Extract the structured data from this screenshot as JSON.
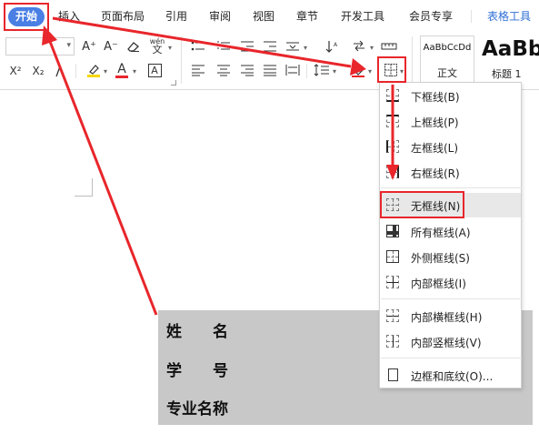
{
  "menu_tabs": {
    "home": "开始",
    "insert": "插入",
    "layout": "页面布局",
    "references": "引用",
    "review": "审阅",
    "view": "视图",
    "sections": "章节",
    "developer": "开发工具",
    "member": "会员专享",
    "table_tools": "表格工具"
  },
  "ribbon": {
    "font_size_up": "A⁺",
    "font_size_down": "A⁻",
    "pinyin_label": "wén",
    "superscript": "X²",
    "subscript": "X₂",
    "font_color_letter": "A",
    "char_border_letter": "A"
  },
  "styles": {
    "normal_sample": "AaBbCcDd",
    "normal_name": "正文",
    "heading1_sample": "AaBb",
    "heading1_name": "标题 1"
  },
  "border_menu": {
    "items": [
      {
        "label": "下框线(B)",
        "icon": "border-bottom-icon"
      },
      {
        "label": "上框线(P)",
        "icon": "border-top-icon"
      },
      {
        "label": "左框线(L)",
        "icon": "border-left-icon"
      },
      {
        "label": "右框线(R)",
        "icon": "border-right-icon"
      },
      {
        "label": "无框线(N)",
        "icon": "border-none-icon"
      },
      {
        "label": "所有框线(A)",
        "icon": "border-all-icon"
      },
      {
        "label": "外侧框线(S)",
        "icon": "border-outside-icon"
      },
      {
        "label": "内部框线(I)",
        "icon": "border-inside-icon"
      },
      {
        "label": "内部横框线(H)",
        "icon": "border-inside-horizontal-icon"
      },
      {
        "label": "内部竖框线(V)",
        "icon": "border-inside-vertical-icon"
      },
      {
        "label": "边框和底纹(O)...",
        "icon": "borders-shading-icon"
      }
    ],
    "highlighted": "无框线(N)"
  },
  "document_table": {
    "rows": [
      "姓　　名",
      "学　　号",
      "专业名称"
    ]
  },
  "colors": {
    "accent_blue": "#4a7fe4",
    "annotation_red": "#e8262b",
    "table_fill": "#c8c8c8"
  }
}
